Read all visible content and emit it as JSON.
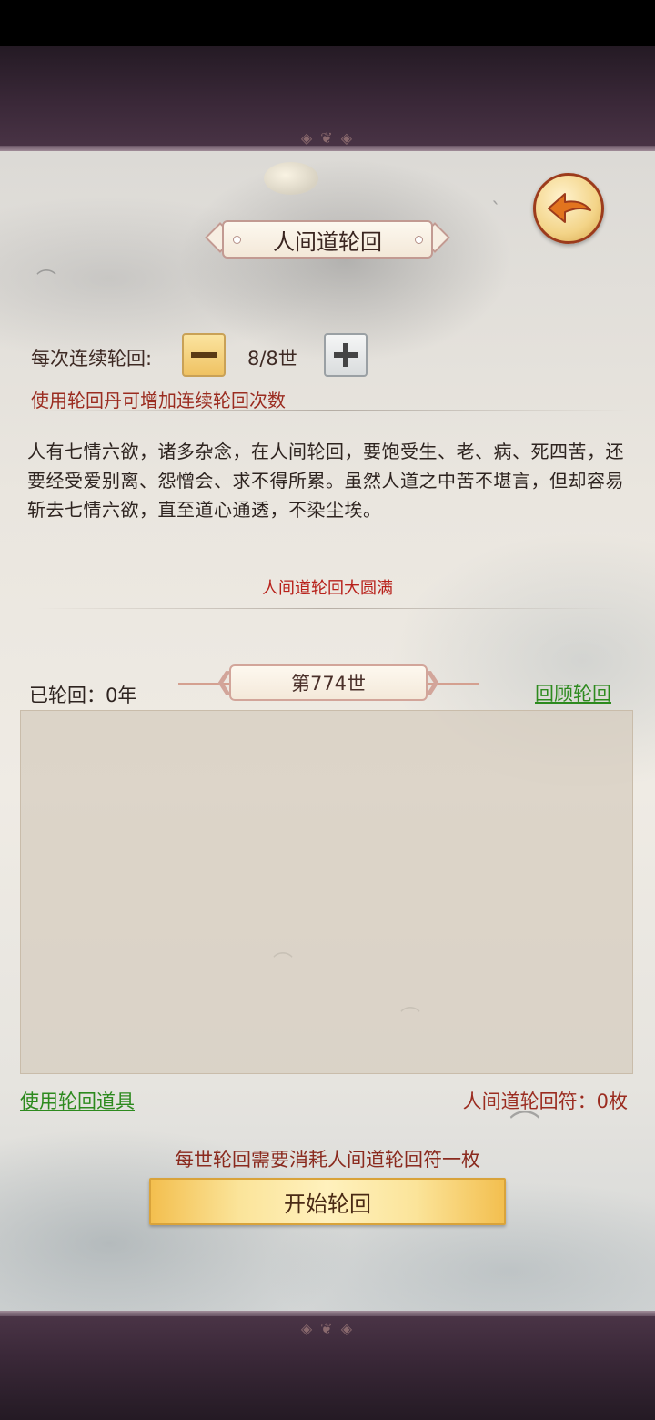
{
  "header": {
    "title": "人间道轮回"
  },
  "stepper": {
    "label": "每次连续轮回:",
    "value": "8/8世"
  },
  "hint": "使用轮回丹可增加连续轮回次数",
  "description": "人有七情六欲，诸多杂念，在人间轮回，要饱受生、老、病、死四苦，还要经受爱别离、怨憎会、求不得所累。虽然人道之中苦不堪言，但却容易斩去七情六欲，直至道心通透，不染尘埃。",
  "completion_status": "人间道轮回大圆满",
  "lifetime": {
    "reincarnated_label": "已轮回：0年",
    "generation": "第774世",
    "review_link": "回顾轮回"
  },
  "footer": {
    "use_item_link": "使用轮回道具",
    "talisman_count": "人间道轮回符：0枚",
    "cost_note": "每世轮回需要消耗人间道轮回符一枚",
    "start_button": "开始轮回"
  },
  "icons": {
    "back": "back-arrow-icon",
    "minus": "minus-icon",
    "plus": "plus-icon"
  },
  "colors": {
    "accent_red": "#9b2c20",
    "link_green": "#2d8a1e",
    "button_gold": "#fbe49a"
  }
}
